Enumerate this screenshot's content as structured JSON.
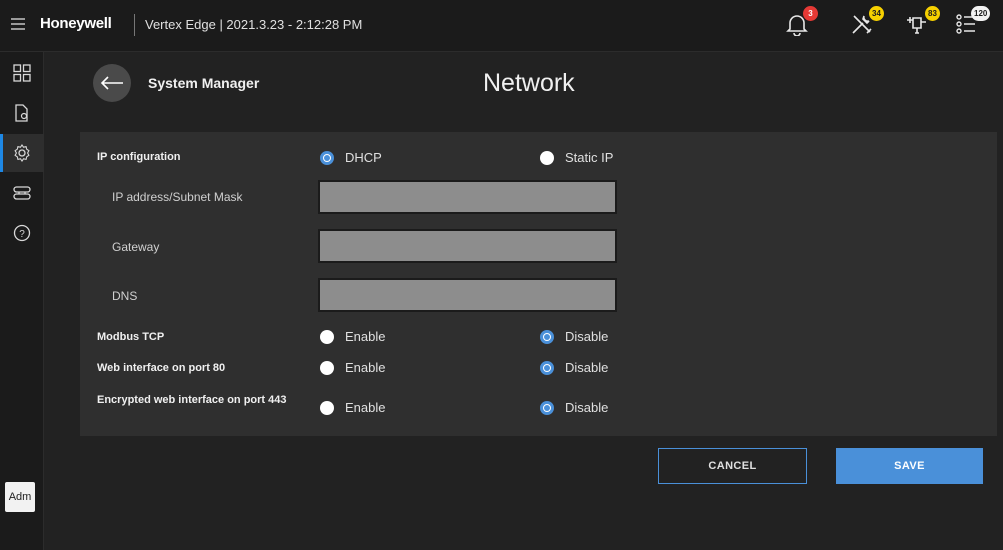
{
  "topbar": {
    "brand": "Honeywell",
    "title": "Vertex Edge | 2021.3.23 - 2:12:28 PM",
    "icons": [
      {
        "name": "bell-icon",
        "badge": "3",
        "badge_color": "#e53935"
      },
      {
        "name": "tools-icon",
        "badge": "34",
        "badge_color": "#f6d000"
      },
      {
        "name": "device-icon",
        "badge": "83",
        "badge_color": "#f6d000"
      },
      {
        "name": "list-icon",
        "badge": "120",
        "badge_color": "#f2f2f2"
      }
    ]
  },
  "sidebar": {
    "items": [
      {
        "name": "dashboard-icon",
        "active": false
      },
      {
        "name": "document-icon",
        "active": false
      },
      {
        "name": "settings-icon",
        "active": true
      },
      {
        "name": "devices-icon",
        "active": false
      },
      {
        "name": "help-icon",
        "active": false
      }
    ],
    "user": "Adm"
  },
  "header": {
    "section": "System Manager",
    "title": "Network"
  },
  "form": {
    "ip_config": {
      "label": "IP configuration",
      "options": [
        "DHCP",
        "Static IP"
      ],
      "selected": "DHCP"
    },
    "ip_address": {
      "label": "IP address/Subnet Mask",
      "value": ""
    },
    "gateway": {
      "label": "Gateway",
      "value": ""
    },
    "dns": {
      "label": "DNS",
      "value": ""
    },
    "modbus": {
      "label": "Modbus TCP",
      "enable": "Enable",
      "disable": "Disable",
      "selected": "Disable"
    },
    "web80": {
      "label": "Web interface on port 80",
      "enable": "Enable",
      "disable": "Disable",
      "selected": "Disable"
    },
    "web443": {
      "label": "Encrypted web interface on port 443",
      "enable": "Enable",
      "disable": "Disable",
      "selected": "Disable"
    }
  },
  "actions": {
    "cancel": "CANCEL",
    "save": "SAVE"
  },
  "colors": {
    "accent": "#4a90d9",
    "background": "#222222",
    "panel": "#2f2f2f"
  }
}
